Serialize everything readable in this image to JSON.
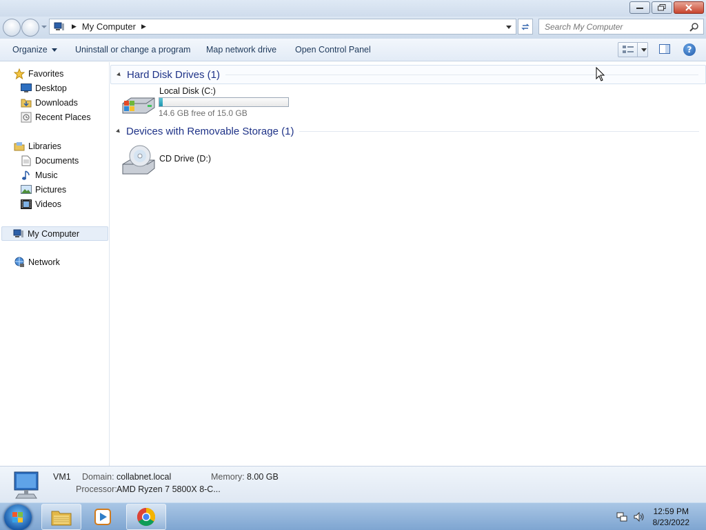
{
  "window": {
    "minimize_icon": "minimize-icon",
    "maximize_icon": "restore-icon",
    "close_icon": "close-icon"
  },
  "address_bar": {
    "location": "My Computer",
    "search_placeholder": "Search My Computer"
  },
  "toolbar": {
    "organize": "Organize",
    "uninstall": "Uninstall or change a program",
    "map_drive": "Map network drive",
    "control_panel": "Open Control Panel"
  },
  "sidebar": {
    "favorites": "Favorites",
    "desktop": "Desktop",
    "downloads": "Downloads",
    "recent_places": "Recent Places",
    "libraries": "Libraries",
    "documents": "Documents",
    "music": "Music",
    "pictures": "Pictures",
    "videos": "Videos",
    "my_computer": "My Computer",
    "network": "Network"
  },
  "content": {
    "hard_disk_group": "Hard Disk Drives (1)",
    "removable_group": "Devices with Removable Storage (1)",
    "drives": [
      {
        "name": "Local Disk (C:)",
        "free_text": "14.6 GB free of 15.0 GB",
        "used_fraction": 0.027
      },
      {
        "name": "CD Drive (D:)"
      }
    ]
  },
  "details": {
    "computer_name": "VM1",
    "domain_label": "Domain:",
    "domain_value": "collabnet.local",
    "memory_label": "Memory:",
    "memory_value": "8.00 GB",
    "processor_label": "Processor:",
    "processor_value": "AMD Ryzen 7 5800X 8-C..."
  },
  "taskbar": {
    "time": "12:59 PM",
    "date": "8/23/2022",
    "apps": [
      "windows-explorer-icon",
      "media-player-icon",
      "chrome-icon"
    ]
  },
  "colors": {
    "accent": "#1e3287",
    "disk_fill": "#26a0b8",
    "taskbar": "#8fb3db"
  }
}
